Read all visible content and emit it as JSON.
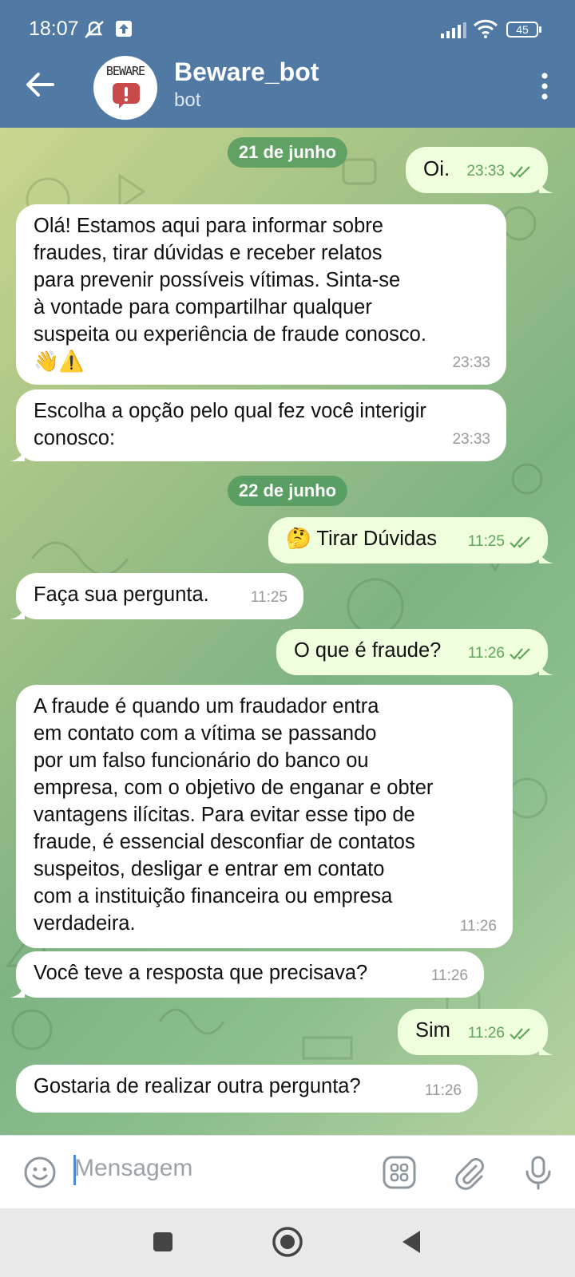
{
  "status_bar": {
    "time": "18:07",
    "battery": "45"
  },
  "header": {
    "title": "Beware_bot",
    "subtitle": "bot",
    "avatar_text": "BEWARE"
  },
  "dates": {
    "first": "21 de junho",
    "second": "22 de junho"
  },
  "messages": [
    {
      "dir": "out",
      "text": "Oi.",
      "time": "23:33"
    },
    {
      "dir": "in",
      "text": "Olá! Estamos aqui para informar sobre\nfraudes, tirar dúvidas e receber relatos\npara prevenir possíveis vítimas. Sinta-se\nà vontade para compartilhar qualquer\nsuspeita ou experiência de fraude conosco.\n👋⚠️",
      "time": "23:33"
    },
    {
      "dir": "in",
      "text": "Escolha a opção pelo qual fez você interigir\nconosco:",
      "time": "23:33"
    },
    {
      "dir": "out",
      "text": "🤔 Tirar Dúvidas",
      "time": "11:25"
    },
    {
      "dir": "in",
      "text": "Faça sua pergunta.",
      "time": "11:25"
    },
    {
      "dir": "out",
      "text": "O que é fraude?",
      "time": "11:26"
    },
    {
      "dir": "in",
      "text": "A fraude é quando um fraudador entra\nem contato com a vítima se passando\npor um falso funcionário do banco ou\nempresa, com o objetivo de enganar e obter\nvantagens ilícitas. Para evitar esse tipo de\nfraude, é essencial desconfiar de contatos\nsuspeitos, desligar e entrar em contato\ncom a instituição financeira ou empresa\nverdadeira.",
      "time": "11:26"
    },
    {
      "dir": "in",
      "text": "Você teve a resposta que precisava?",
      "time": "11:26"
    },
    {
      "dir": "out",
      "text": "Sim",
      "time": "11:26"
    },
    {
      "dir": "in",
      "text": "Gostaria de realizar outra pergunta?",
      "time": "11:26"
    }
  ],
  "input": {
    "placeholder": "Mensagem"
  },
  "colors": {
    "header": "#5079a4",
    "outgoing_bubble": "#effedd",
    "incoming_bubble": "#ffffff",
    "check": "#5fa55a"
  },
  "icons": [
    "back-arrow-icon",
    "more-vert-icon",
    "emoji-icon",
    "bot-keyboard-icon",
    "attach-icon",
    "mic-icon"
  ]
}
